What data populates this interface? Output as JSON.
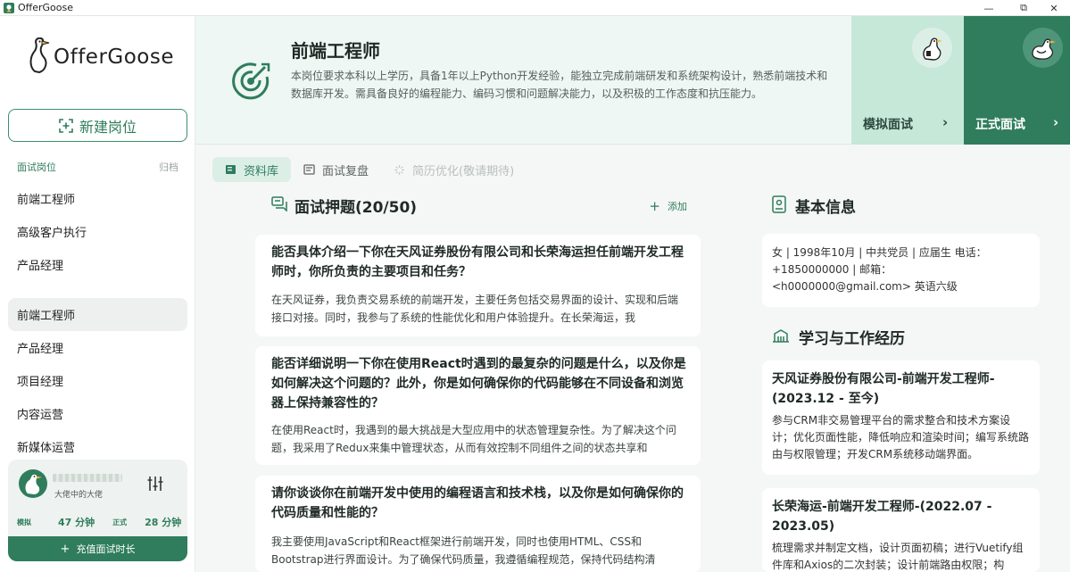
{
  "window": {
    "title": "OfferGoose",
    "minimize": "—",
    "maximize": "⧉",
    "close": "✕"
  },
  "sidebar": {
    "logo_text": "OfferGoose",
    "new_job_label": "新建岗位",
    "section_active": "面试岗位",
    "section_archive": "归档",
    "items": [
      "前端工程师",
      "高级客户执行",
      "产品经理"
    ],
    "items2": [
      "前端工程师",
      "产品经理",
      "项目经理",
      "内容运营",
      "新媒体运营"
    ],
    "active_item": "前端工程师",
    "user": {
      "title": "大佬中的大佬"
    },
    "stats": {
      "mock_label": "模拟",
      "mock_value": "47 分钟",
      "real_label": "正式",
      "real_value": "28 分钟"
    },
    "recharge_label": "充值面试时长"
  },
  "header": {
    "job_title": "前端工程师",
    "job_desc": "本岗位要求本科以上学历，具备1年以上Python开发经验，能独立完成前端研发和系统架构设计，熟悉前端技术和数据库开发。需具备良好的编程能力、编码习惯和问题解决能力，以及积极的工作态度和抗压能力。",
    "mock_label": "模拟面试",
    "real_label": "正式面试"
  },
  "tabs": [
    {
      "label": "资料库",
      "state": "active"
    },
    {
      "label": "面试复盘",
      "state": "inactive"
    },
    {
      "label": "简历优化(敬请期待)",
      "state": "disabled"
    }
  ],
  "questions": {
    "title": "面试押题(20/50)",
    "add_label": "添加",
    "items": [
      {
        "q": "能否具体介绍一下你在天风证券股份有限公司和长荣海运担任前端开发工程师时，你所负责的主要项目和任务？",
        "a": "在天风证券，我负责交易系统的前端开发，主要任务包括交易界面的设计、实现和后端接口对接。同时，我参与了系统的性能优化和用户体验提升。在长荣海运，我"
      },
      {
        "q": "能否详细说明一下你在使用React时遇到的最复杂的问题是什么，以及你是如何解决这个问题的？此外，你是如何确保你的代码能够在不同设备和浏览器上保持兼容性的？",
        "a": "在使用React时，我遇到的最大挑战是大型应用中的状态管理复杂性。为了解决这个问题，我采用了Redux来集中管理状态，从而有效控制不同组件之间的状态共享和"
      },
      {
        "q": "请你谈谈你在前端开发中使用的编程语言和技术栈，以及你是如何确保你的代码质量和性能的？",
        "a": "我主要使用JavaScript和React框架进行前端开发，同时也使用HTML、CSS和Bootstrap进行界面设计。为了确保代码质量，我遵循编程规范，保持代码结构清"
      }
    ]
  },
  "basic_info": {
    "title": "基本信息",
    "text": "女 | 1998年10月 | 中共党员 | 应届生 电话：+1850000000 | 邮箱：<h0000000@gmail.com> 英语六级"
  },
  "experience": {
    "title": "学习与工作经历",
    "items": [
      {
        "title": "天风证券股份有限公司-前端开发工程师-(2023.12 - 至今)",
        "desc": "参与CRM非交易管理平台的需求整合和技术方案设计；优化页面性能，降低响应和渲染时间；编写系统路由与权限管理；开发CRM系统移动端界面。"
      },
      {
        "title": "长荣海运-前端开发工程师-(2022.07 - 2023.05)",
        "desc": "梳理需求并制定文档，设计页面初稿；进行Vuetify组件库和Axios的二次封装；设计前端路由权限；构"
      }
    ]
  },
  "colors": {
    "accent": "#2f7d5c",
    "accent_light": "#dcefe6",
    "header_bg": "#eef7f3",
    "mock_bg": "#c6e8d9"
  }
}
